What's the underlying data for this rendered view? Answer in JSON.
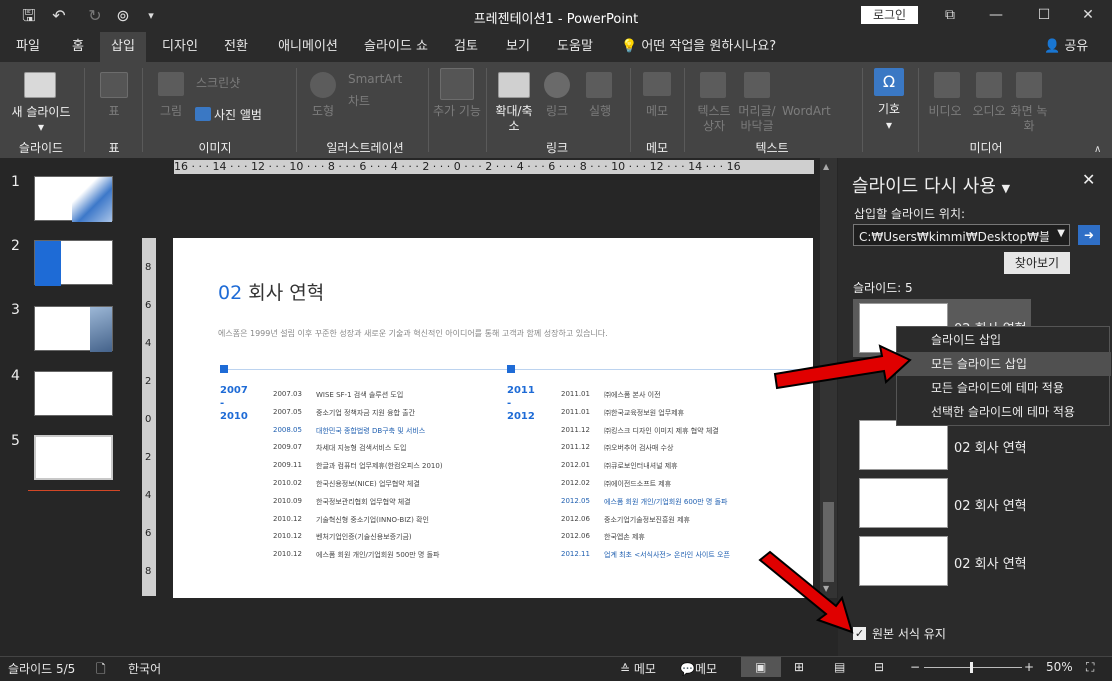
{
  "title_bar": {
    "document": "프레젠테이션1",
    "app": "PowerPoint",
    "title": "프레젠테이션1  -  PowerPoint",
    "login": "로그인"
  },
  "tabs": [
    "파일",
    "홈",
    "삽입",
    "디자인",
    "전환",
    "애니메이션",
    "슬라이드 쇼",
    "검토",
    "보기",
    "도움말"
  ],
  "tell_me": "어떤 작업을 원하시나요?",
  "share": "공유",
  "ribbon": {
    "new_slide": "새 슬라이드",
    "table": "표",
    "picture": "그림",
    "screenshot": "스크린샷",
    "photo_album": "사진 앨범",
    "shapes": "도형",
    "smartart": "SmartArt",
    "chart": "차트",
    "addins": "추가 기능",
    "zoom": "확대/축소",
    "link": "링크",
    "action": "실행",
    "comment": "메모",
    "textbox": "텍스트 상자",
    "header_footer": "머리글/ 바닥글",
    "wordart": "WordArt",
    "symbols": "기호",
    "video": "비디오",
    "audio": "오디오",
    "screen_recording": "화면 녹화",
    "groups": [
      "슬라이드",
      "표",
      "이미지",
      "일러스트레이션",
      "링크",
      "메모",
      "텍스트",
      "미디어"
    ]
  },
  "thumbnails": [
    "1",
    "2",
    "3",
    "4",
    "5"
  ],
  "ruler_h": "16 · · · 14 · · · 12 · · · 10 · · · 8 · · · 6 · · · 4 · · · 2 · · · 0 · · · 2 · · · 4 · · · 6 · · · 8 · · · 10 · · · 12 · · · 14 · · · 16",
  "ruler_v": [
    "8",
    "6",
    "4",
    "2",
    "0",
    "2",
    "4",
    "6",
    "8"
  ],
  "slide": {
    "number": "02",
    "heading": "회사 연혁",
    "subtitle": "에스폼은 1999년 설립 이후 꾸준한 성장과 새로운 기술과 혁신적인 아이디어를 통해 고객과 함께 성장하고 있습니다.",
    "period1": "2007 - 2010",
    "period2": "2011 - 2012",
    "left_rows": [
      {
        "date": "2007.03",
        "text": "WISE SF-1 검색 솔루션 도입",
        "blue": false
      },
      {
        "date": "2007.05",
        "text": "중소기업 정책자금 지원 융합 출간",
        "blue": false
      },
      {
        "date": "2008.05",
        "text": "대한민국 종합법령 DB구축 및 서비스",
        "blue": true
      },
      {
        "date": "2009.07",
        "text": "차세대 지능형 검색서비스 도입",
        "blue": false
      },
      {
        "date": "2009.11",
        "text": "한글과 컴퓨터 업무제휴(한컴오피스 2010)",
        "blue": false
      },
      {
        "date": "2010.02",
        "text": "한국신용정보(NICE) 업무협약 체결",
        "blue": false
      },
      {
        "date": "2010.09",
        "text": "한국정보관리협회 업무협약 체결",
        "blue": false
      },
      {
        "date": "2010.12",
        "text": "기술혁신형 중소기업(INNO-BIZ) 확인",
        "blue": false
      },
      {
        "date": "2010.12",
        "text": "벤처기업인증(기술신용보증기금)",
        "blue": false
      },
      {
        "date": "2010.12",
        "text": "에스폼 회원 개인/기업회원 500만 명 돌파",
        "blue": false
      }
    ],
    "right_rows": [
      {
        "date": "2011.01",
        "text": "㈜에스폼 본사 이전",
        "blue": false
      },
      {
        "date": "2011.01",
        "text": "㈜한국교육정보원 업무제휴",
        "blue": false
      },
      {
        "date": "2011.12",
        "text": "㈜킹스크 디자인 이미지 제휴 협약 체결",
        "blue": false
      },
      {
        "date": "2011.12",
        "text": "㈜오버추어 검사매 수상",
        "blue": false
      },
      {
        "date": "2012.01",
        "text": "㈜큐로보인터내셔널 제휴",
        "blue": false
      },
      {
        "date": "2012.02",
        "text": "㈜에이전드소프트 제휴",
        "blue": false
      },
      {
        "date": "2012.05",
        "text": "에스폼 회원 개인/기업회원 600만 명 돌파",
        "blue": true
      },
      {
        "date": "2012.06",
        "text": "중소기업기술정보진흥원 제휴",
        "blue": false
      },
      {
        "date": "2012.06",
        "text": "한국엡손 제휴",
        "blue": false
      },
      {
        "date": "2012.11",
        "text": "업계 최초 <서식사전> 온라인 사이트 오픈",
        "blue": true
      }
    ]
  },
  "pane": {
    "title": "슬라이드 다시 사용",
    "insert_location_label": "삽입할 슬라이드 위치:",
    "path": "C:₩Users₩kimmi₩Desktop₩블로그",
    "browse": "찾아보기",
    "slides_label": "슬라이드: 5",
    "context_menu": [
      "슬라이드 삽입",
      "모든 슬라이드 삽입",
      "모든 슬라이드에 테마 적용",
      "선택한 슬라이드에 테마 적용"
    ],
    "slide_items": [
      "02 회사 연혁",
      "02 회사 연혁",
      "02 회사 연혁",
      "02 회사 연혁"
    ],
    "keep_format": "원본 서식 유지"
  },
  "status": {
    "slide": "슬라이드 5/5",
    "language": "한국어",
    "notes": "메모",
    "comments": "메모",
    "zoom": "50%"
  }
}
